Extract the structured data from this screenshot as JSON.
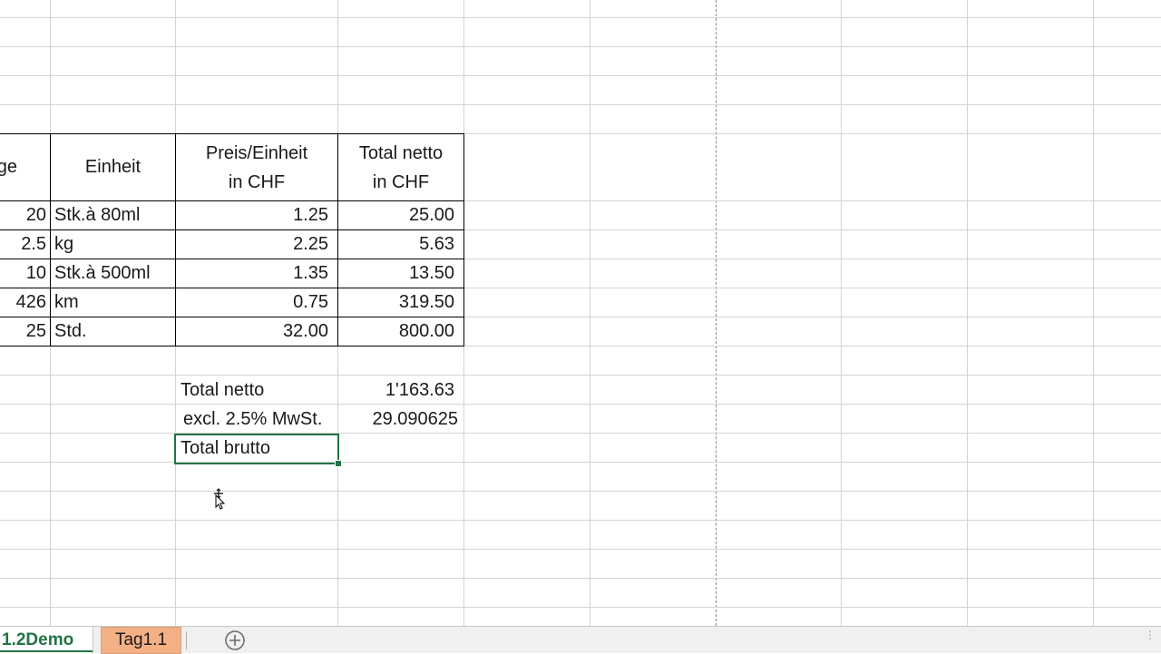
{
  "table": {
    "headers": {
      "col_a": "ge",
      "col_b": "Einheit",
      "col_c_line1": "Preis/Einheit",
      "col_c_line2": "in CHF",
      "col_d_line1": "Total netto",
      "col_d_line2": "in CHF"
    },
    "rows": [
      {
        "menge": "20",
        "einheit": "Stk.à 80ml",
        "preis": "1.25",
        "total": "25.00"
      },
      {
        "menge": "2.5",
        "einheit": "kg",
        "preis": "2.25",
        "total": "5.63"
      },
      {
        "menge": "10",
        "einheit": "Stk.à 500ml",
        "preis": "1.35",
        "total": "13.50"
      },
      {
        "menge": "426",
        "einheit": "km",
        "preis": "0.75",
        "total": "319.50"
      },
      {
        "menge": "25",
        "einheit": "Std.",
        "preis": "32.00",
        "total": "800.00"
      }
    ]
  },
  "summary": {
    "total_netto_label": "Total netto",
    "total_netto_value": "1'163.63",
    "mwst_label": "excl. 2.5% MwSt.",
    "mwst_value": "29.090625",
    "total_brutto_label": "Total brutto"
  },
  "sheet_tabs": {
    "active": "1.2Demo",
    "second": "Tag1.1",
    "add_icon": "plus-circle-icon"
  },
  "colors": {
    "accent": "#217346",
    "tab_second": "#f4b084",
    "gridline": "#d4d4d4"
  }
}
